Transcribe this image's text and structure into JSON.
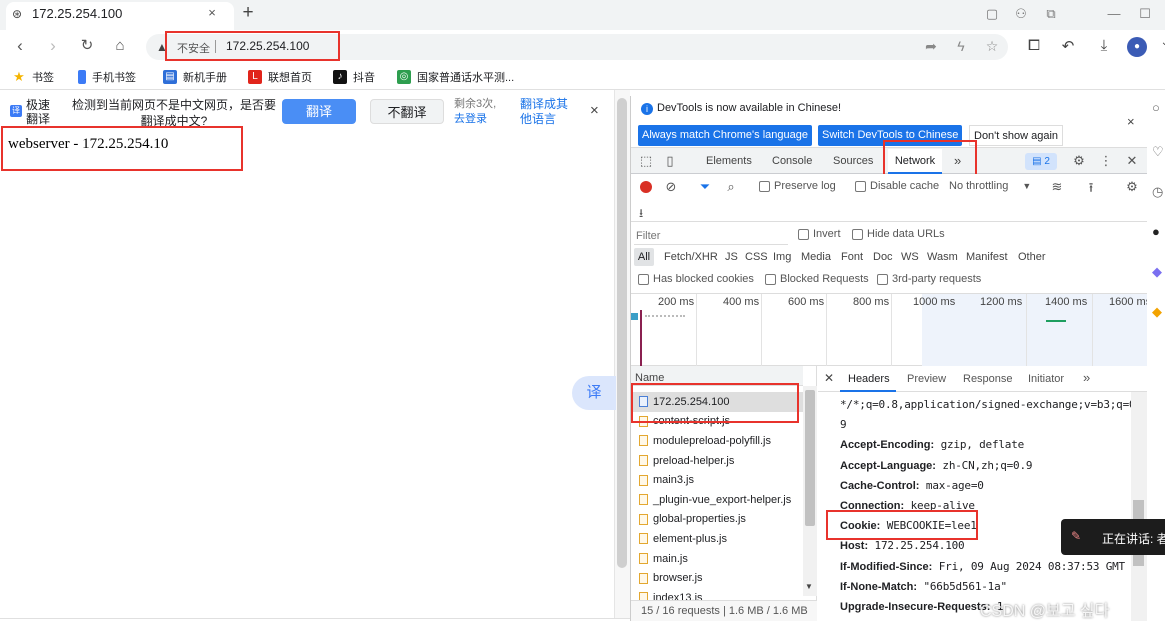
{
  "browser": {
    "tab_title": "172.25.254.100",
    "tab_close": "×",
    "new_tab": "+",
    "window_controls": {
      "minimize": "—",
      "maximize": "☐",
      "chevron": "⌄"
    },
    "omnibox": {
      "security_label": "不安全",
      "url": "172.25.254.100"
    }
  },
  "bookmarks": [
    {
      "label": "书签",
      "color": "#f5b400",
      "icon": "★"
    },
    {
      "label": "手机书签",
      "color": "#3c7bf6",
      "icon": "▮"
    },
    {
      "label": "新机手册",
      "color": "#2f6fd8",
      "icon": "▤"
    },
    {
      "label": "联想首页",
      "color": "#e1251b",
      "icon": "L"
    },
    {
      "label": "抖音",
      "color": "#111111",
      "icon": "♪"
    },
    {
      "label": "国家普通话水平测...",
      "color": "#2e9e4f",
      "icon": "◎"
    }
  ],
  "translate_bar": {
    "name": "极速翻译",
    "message": "检测到当前网页不是中文网页，是否要翻译成中文?",
    "translate_button": "翻译",
    "no_translate_button": "不翻译",
    "remaining": "剩余3次,",
    "login_link": "去登录",
    "other_language": "翻译成其他语言",
    "close": "×"
  },
  "page": {
    "heading": "webserver - 172.25.254.10",
    "fab_label": "译"
  },
  "devtools": {
    "info_text": "DevTools is now available in Chinese!",
    "btn_match": "Always match Chrome's language",
    "btn_switch": "Switch DevTools to Chinese",
    "btn_dontshow": "Don't show again",
    "tabs": [
      "Elements",
      "Console",
      "Sources",
      "Network"
    ],
    "more": "»",
    "issues_badge": "2",
    "toolbar": {
      "preserve_log": "Preserve log",
      "disable_cache": "Disable cache",
      "throttling": "No throttling"
    },
    "filter": {
      "placeholder": "Filter",
      "invert": "Invert",
      "hide_data_urls": "Hide data URLs",
      "types": [
        "All",
        "Fetch/XHR",
        "JS",
        "CSS",
        "Img",
        "Media",
        "Font",
        "Doc",
        "WS",
        "Wasm",
        "Manifest",
        "Other"
      ],
      "has_blocked_cookies": "Has blocked cookies",
      "blocked_requests": "Blocked Requests",
      "third_party": "3rd-party requests"
    },
    "timeline_ticks": [
      "200 ms",
      "400 ms",
      "600 ms",
      "800 ms",
      "1000 ms",
      "1200 ms",
      "1400 ms",
      "1600 ms"
    ],
    "requests_header": "Name",
    "requests": [
      {
        "name": "172.25.254.100",
        "type": "doc"
      },
      {
        "name": "content-script.js",
        "type": "js"
      },
      {
        "name": "modulepreload-polyfill.js",
        "type": "js"
      },
      {
        "name": "preload-helper.js",
        "type": "js"
      },
      {
        "name": "main3.js",
        "type": "js"
      },
      {
        "name": "_plugin-vue_export-helper.js",
        "type": "js"
      },
      {
        "name": "global-properties.js",
        "type": "js"
      },
      {
        "name": "element-plus.js",
        "type": "js"
      },
      {
        "name": "main.js",
        "type": "js"
      },
      {
        "name": "browser.js",
        "type": "js"
      },
      {
        "name": "index13.js",
        "type": "js"
      }
    ],
    "status": "15 / 16 requests  |  1.6 MB / 1.6 MB",
    "panel_tabs": [
      "Headers",
      "Preview",
      "Response",
      "Initiator"
    ],
    "headers": [
      {
        "key": "",
        "value": "*/*;q=0.8,application/signed-exchange;v=b3;q=0."
      },
      {
        "key": "",
        "value": "9"
      },
      {
        "key": "Accept-Encoding:",
        "value": "gzip, deflate"
      },
      {
        "key": "Accept-Language:",
        "value": "zh-CN,zh;q=0.9"
      },
      {
        "key": "Cache-Control:",
        "value": "max-age=0"
      },
      {
        "key": "Connection:",
        "value": "keep-alive"
      },
      {
        "key": "Cookie:",
        "value": "WEBCOOKIE=lee1"
      },
      {
        "key": "Host:",
        "value": "172.25.254.100"
      },
      {
        "key": "If-Modified-Since:",
        "value": "Fri, 09 Aug 2024 08:37:53 GMT"
      },
      {
        "key": "If-None-Match:",
        "value": "\"66b5d561-1a\""
      },
      {
        "key": "Upgrade-Insecure-Requests:",
        "value": "1"
      }
    ]
  },
  "overlay": {
    "speaker_label": "正在讲话: 者",
    "watermark": "CSDN @보고 싶다"
  }
}
